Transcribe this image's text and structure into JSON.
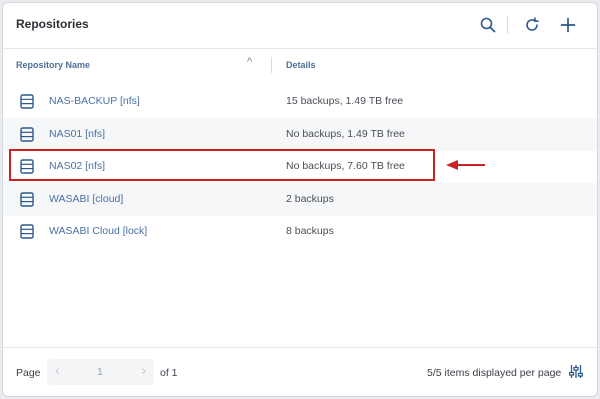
{
  "header": {
    "title": "Repositories"
  },
  "columns": {
    "name_label": "Repository Name",
    "details_label": "Details",
    "sort_indicator": "^"
  },
  "repositories": [
    {
      "name": "NAS-BACKUP [nfs]",
      "details": "15 backups, 1.49 TB free"
    },
    {
      "name": "NAS01 [nfs]",
      "details": "No backups, 1.49 TB free"
    },
    {
      "name": "NAS02 [nfs]",
      "details": "No backups, 7.60 TB free"
    },
    {
      "name": "WASABI [cloud]",
      "details": "2 backups"
    },
    {
      "name": "WASABI Cloud [lock]",
      "details": "8 backups"
    }
  ],
  "footer": {
    "page_label": "Page",
    "prev_glyph": "‹",
    "current_page": "1",
    "next_glyph": "›",
    "of_label": "of 1",
    "per_page_text": "5/5 items displayed per page"
  },
  "icons": {
    "header": [
      "search-icon",
      "refresh-icon",
      "add-icon"
    ],
    "row": "repository-icon",
    "footer": "settings-sliders-icon",
    "annotation": "arrow-left-icon"
  },
  "colors": {
    "accent": "#2c5a8c",
    "link_text": "#4a71a5",
    "highlight_border": "#cc2222"
  }
}
